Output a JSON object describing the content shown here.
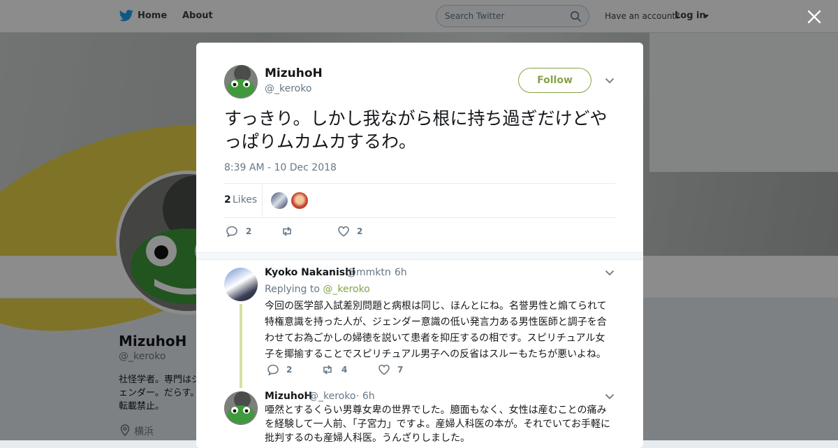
{
  "nav": {
    "home_label": "Home",
    "about_label": "About",
    "search_placeholder": "Search Twitter",
    "account_prompt": "Have an account?",
    "login_label": "Log in"
  },
  "profile_bg": {
    "name": "MizuhoH",
    "handle": "@_keroko",
    "bio": "社怪学者。専門はジェンダー。だらす。転載禁止。",
    "location": "横浜"
  },
  "tweet": {
    "author_name": "MizuhoH",
    "author_handle": "@_keroko",
    "follow_label": "Follow",
    "text": "すっきり。しかし我ながら根に持ち過ぎだけどやっぱりムカムカするわ。",
    "timestamp": "8:39 AM - 10 Dec 2018",
    "likes_count": "2",
    "likes_label": "Likes",
    "reply_count": "2",
    "like_count": "2"
  },
  "replies": [
    {
      "name": "Kyoko Nakanishi",
      "handle": "@mmktn",
      "time": "· 6h",
      "replying_prefix": "Replying to",
      "replying_to": "@_keroko",
      "text": "今回の医学部入試差別問題と病根は同じ、ほんとにね。名誉男性と煽てられて特権意識を持った人が、ジェンダー意識の低い発言力ある男性医師と調子を合わせてお為ごかしの婦徳を説いて患者を抑圧するの相です。スピリチュアル女子を揶揄することでスピリチュアル男子への反省はスルーもたちが悪いよね。",
      "replies": "2",
      "retweets": "4",
      "likes": "7"
    },
    {
      "name": "MizuhoH",
      "handle": "@_keroko",
      "time": "· 6h",
      "text": "唖然とするくらい男尊女卑の世界でした。臆面もなく、女性は産むことの痛みを経験して一人前、「子宮力」ですよ。産婦人科医の本が。それでいてお手軽に批判するのも産婦人科医。うんざりしました。"
    }
  ],
  "colors": {
    "accent": "#84a348",
    "text": "#14171a",
    "muted": "#657786",
    "thread_line": "#d8df9f"
  },
  "icons": [
    "twitter-bird-icon",
    "search-icon",
    "close-icon",
    "chevron-down-icon",
    "reply-icon",
    "retweet-icon",
    "heart-icon",
    "location-pin-icon"
  ]
}
